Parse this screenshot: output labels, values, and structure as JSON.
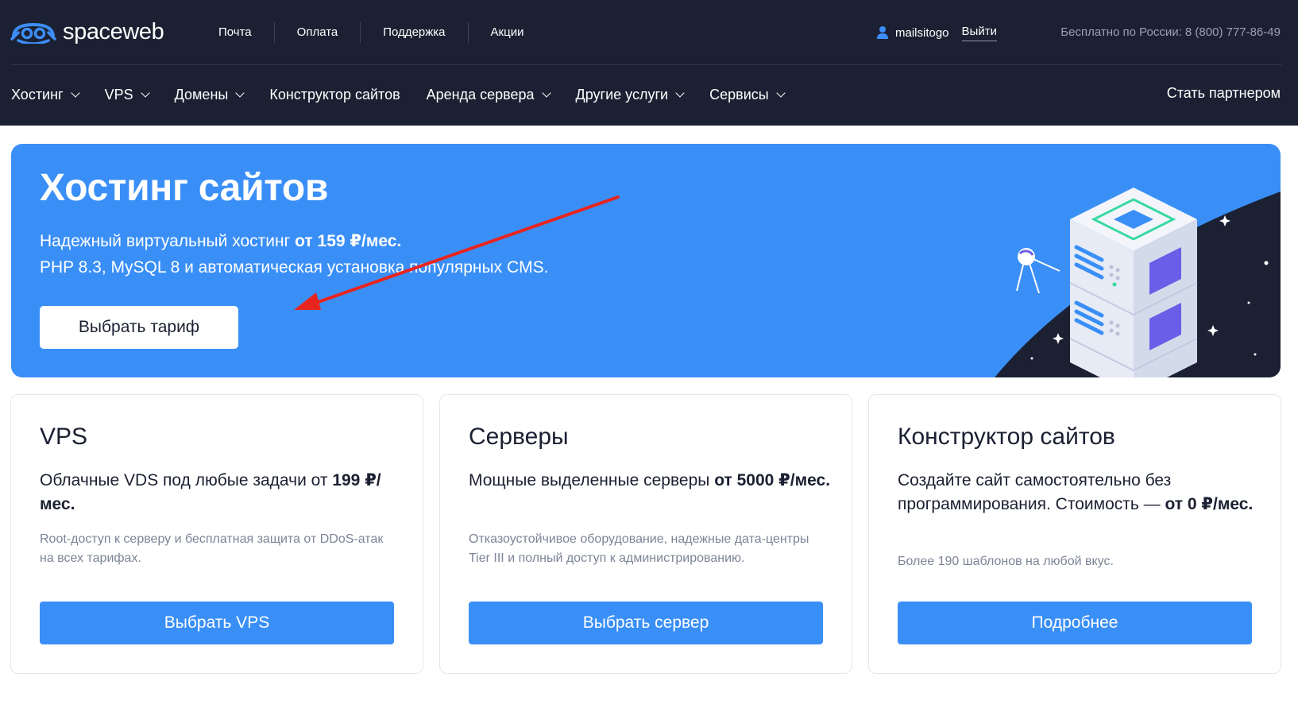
{
  "header": {
    "logo_text": "spaceweb",
    "top_links": [
      "Почта",
      "Оплата",
      "Поддержка",
      "Акции"
    ],
    "username": "mailsitogo",
    "logout": "Выйти",
    "phone": "Бесплатно по России: 8 (800) 777-86-49",
    "nav": [
      {
        "label": "Хостинг"
      },
      {
        "label": "VPS"
      },
      {
        "label": "Домены"
      },
      {
        "label": "Конструктор сайтов"
      },
      {
        "label": "Аренда сервера"
      },
      {
        "label": "Другие услуги"
      },
      {
        "label": "Сервисы"
      }
    ],
    "partner": "Стать партнером"
  },
  "hero": {
    "title": "Хостинг сайтов",
    "line1_prefix": "Надежный виртуальный хостинг ",
    "line1_bold": "от 159 ₽/мес.",
    "line2": "PHP 8.3, MySQL 8 и автоматическая установка популярных CMS.",
    "button": "Выбрать тариф"
  },
  "cards": [
    {
      "title": "VPS",
      "desc_prefix": "Облачные VDS под любые задачи от ",
      "desc_bold": "199 ₽/мес.",
      "note": "Root-доступ к серверу и бесплатная защита от DDoS-атак на всех тарифах.",
      "button": "Выбрать VPS"
    },
    {
      "title": "Серверы",
      "desc_prefix": "Мощные выделенные серверы ",
      "desc_bold": "от 5000 ₽/мес.",
      "note": "Отказоустойчивое оборудование, надежные дата-центры Tier III и полный доступ к администрированию.",
      "button": "Выбрать сервер"
    },
    {
      "title": "Конструктор сайтов",
      "desc_prefix": "Создайте сайт самостоятельно без программирования. Стоимость — ",
      "desc_bold": "от 0 ₽/мес.",
      "note": "Более 190 шаблонов на любой вкус.",
      "button": "Подробнее"
    }
  ],
  "colors": {
    "header_bg": "#1b2133",
    "accent": "#3a8ff7",
    "annotation_arrow": "#e8241f"
  },
  "icons": [
    "spaceweb-logo-icon",
    "user-icon",
    "chevron-down-icon",
    "server-illustration",
    "satellite-icon",
    "red-arrow-annotation"
  ]
}
